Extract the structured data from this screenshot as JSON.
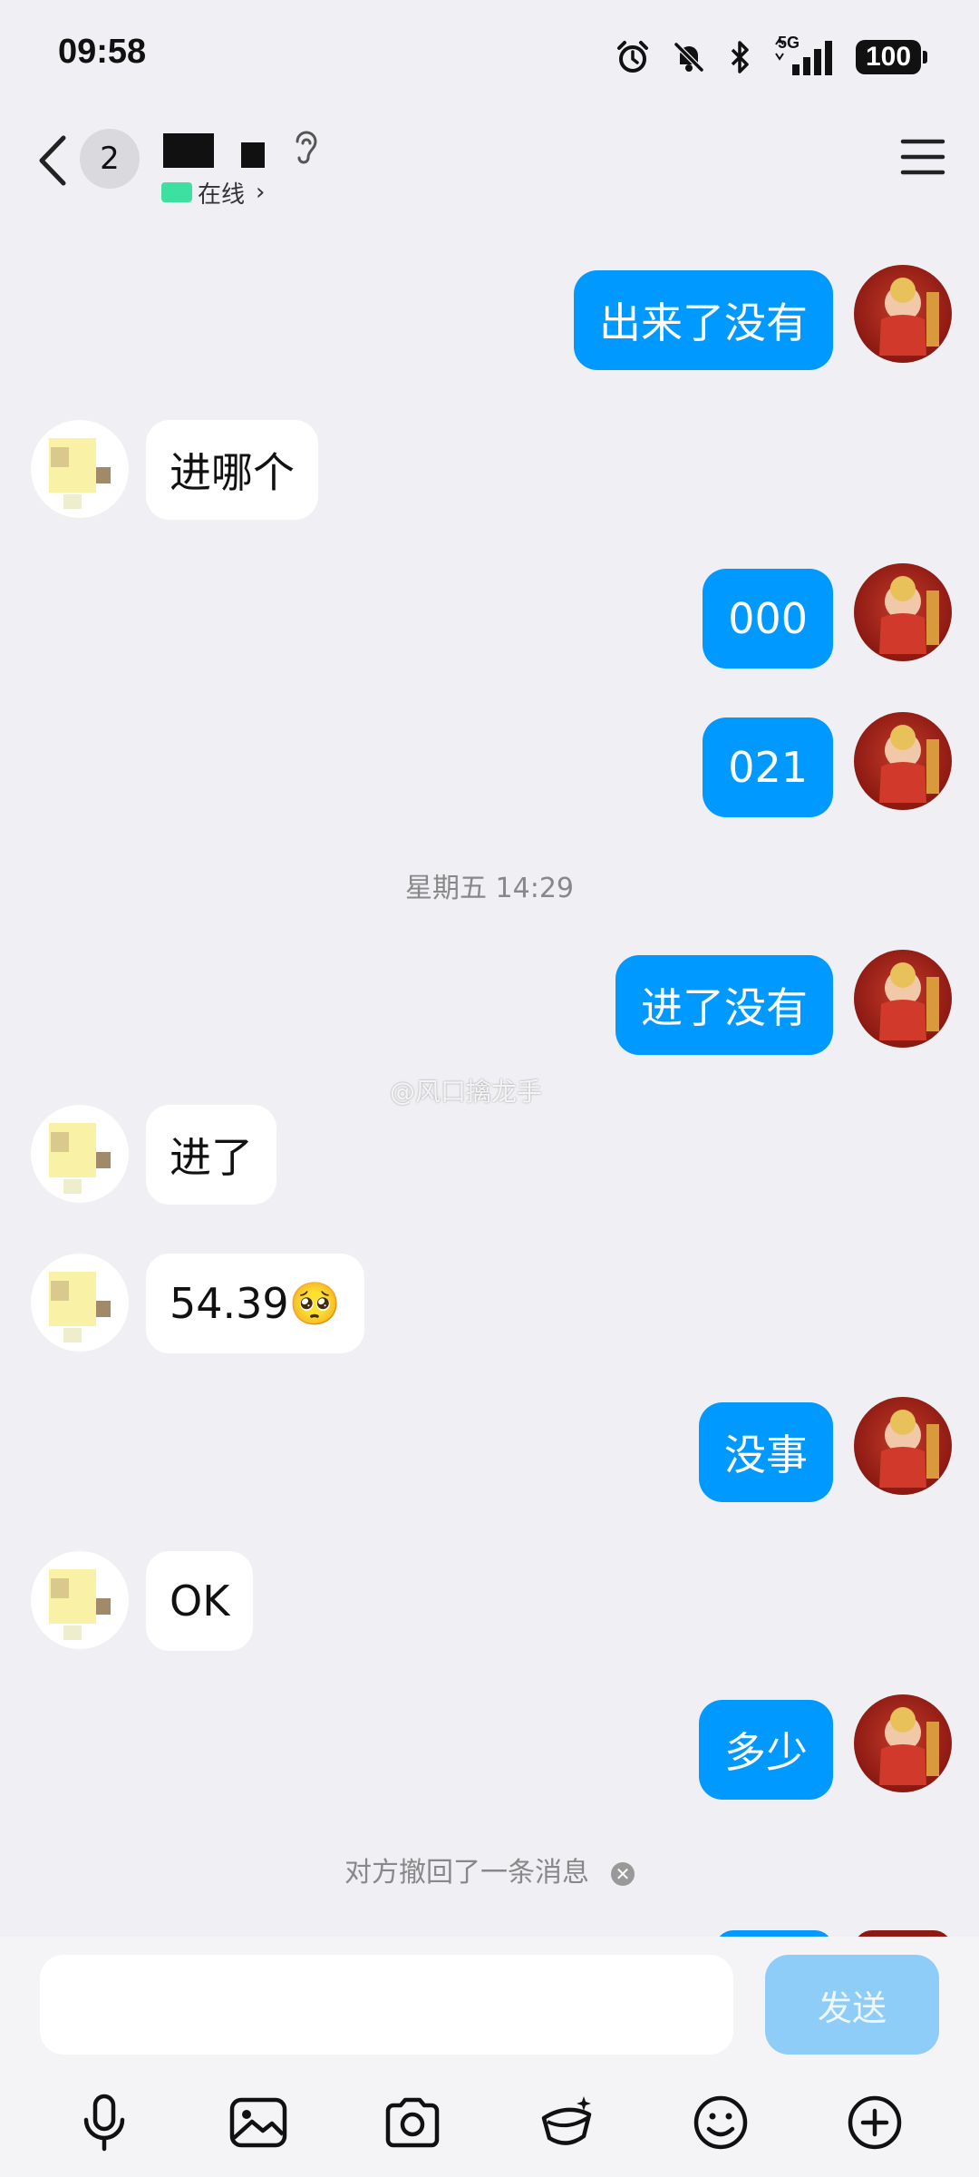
{
  "status_bar": {
    "time": "09:58",
    "network": "5G",
    "battery": "100"
  },
  "header": {
    "unread_count": "2",
    "online_status": "在线"
  },
  "messages": [
    {
      "side": "out",
      "text": "出来了没有"
    },
    {
      "side": "in",
      "text": "进哪个"
    },
    {
      "side": "out",
      "text": "000"
    },
    {
      "side": "out",
      "text": "021"
    },
    {
      "type": "time",
      "text": "星期五 14:29"
    },
    {
      "side": "out",
      "text": "进了没有"
    },
    {
      "side": "in",
      "text": "进了"
    },
    {
      "side": "in",
      "text": "54.39🥺"
    },
    {
      "side": "out",
      "text": "没事"
    },
    {
      "side": "in",
      "text": "OK"
    },
    {
      "side": "out",
      "text": "多少"
    },
    {
      "type": "recall",
      "text": "对方撤回了一条消息"
    }
  ],
  "watermark": "@风口擒龙手",
  "input": {
    "value": "",
    "placeholder": "",
    "send_label": "发送"
  },
  "toolbar": [
    "microphone-icon",
    "image-icon",
    "camera-icon",
    "red-packet-icon",
    "emoji-icon",
    "plus-icon"
  ],
  "colors": {
    "bubble_out": "#0099ff",
    "bubble_in": "#ffffff",
    "background": "#efeff4",
    "send_disabled": "#8dcdf8"
  }
}
